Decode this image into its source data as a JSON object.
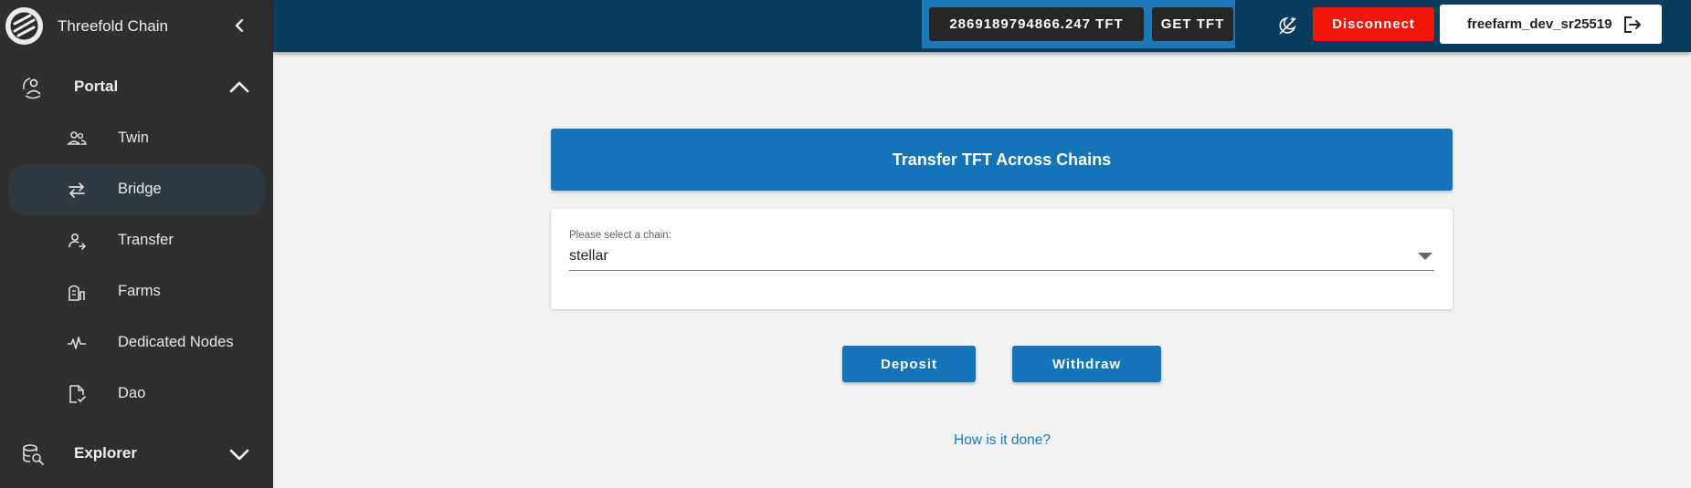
{
  "sidebar": {
    "app_title": "Threefold Chain",
    "logo_icon": "threefold-logo-icon",
    "groups": [
      {
        "label": "Portal",
        "icon": "portal-icon",
        "expanded": true
      },
      {
        "label": "Explorer",
        "icon": "explorer-icon",
        "expanded": false
      }
    ],
    "items": [
      {
        "label": "Twin",
        "icon": "twin-icon",
        "active": false
      },
      {
        "label": "Bridge",
        "icon": "bridge-icon",
        "active": true
      },
      {
        "label": "Transfer",
        "icon": "transfer-icon",
        "active": false
      },
      {
        "label": "Farms",
        "icon": "farms-icon",
        "active": false
      },
      {
        "label": "Dedicated Nodes",
        "icon": "dedicated-nodes-icon",
        "active": false
      },
      {
        "label": "Dao",
        "icon": "dao-icon",
        "active": false
      }
    ]
  },
  "topbar": {
    "balance": "2869189794866.247 TFT",
    "get_tft_label": "GET TFT",
    "disconnect_label": "Disconnect",
    "account_name": "freefarm_dev_sr25519",
    "colors": {
      "bar": "#0a3c5e",
      "wallet_border": "#1b79ba",
      "disconnect": "#f3160c"
    }
  },
  "main": {
    "card_title": "Transfer TFT Across Chains",
    "chain_select": {
      "label": "Please select a chain:",
      "value": "stellar"
    },
    "deposit_label": "Deposit",
    "withdraw_label": "Withdraw",
    "help_link": "How is it done?",
    "colors": {
      "primary": "#1374b8",
      "link": "#1b79ba"
    }
  }
}
